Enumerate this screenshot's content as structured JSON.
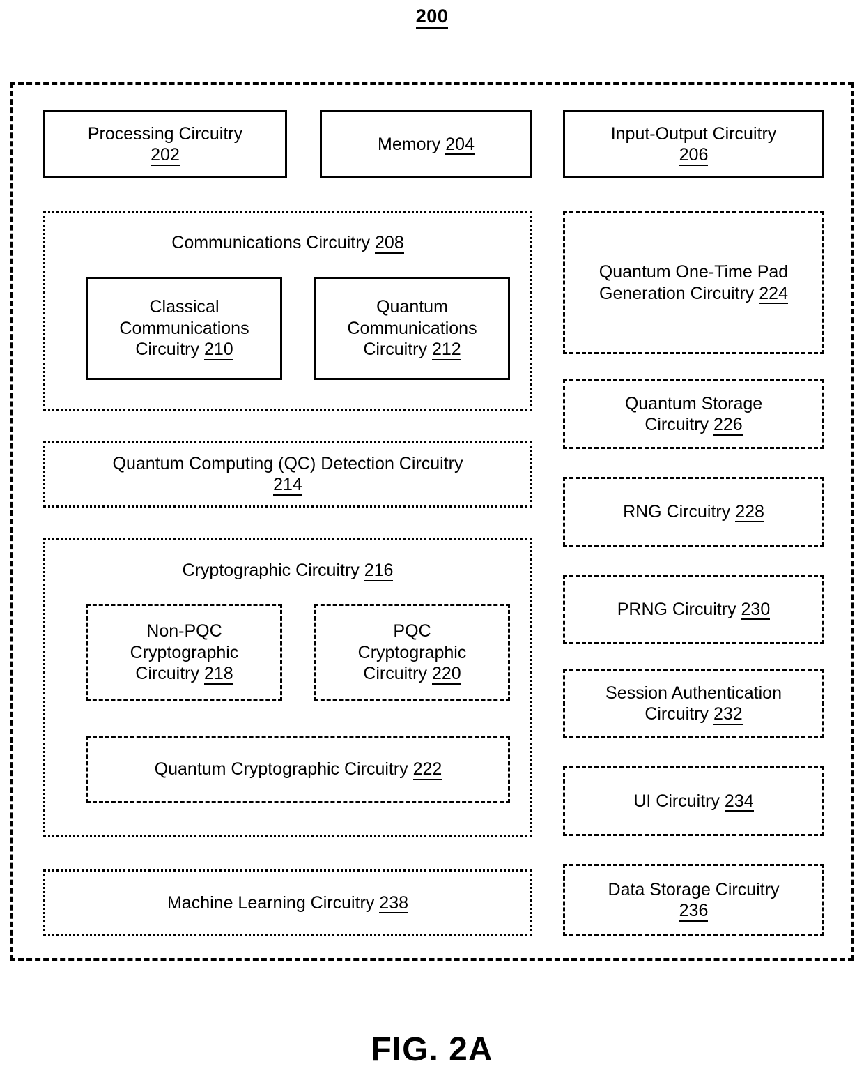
{
  "figure": {
    "number": "200",
    "caption": "FIG. 2A"
  },
  "apparatus": {
    "top_row": [
      {
        "name": "processing-circuitry",
        "title": "Processing Circuitry",
        "ref": "202",
        "style": "solid"
      },
      {
        "name": "memory",
        "title": "Memory",
        "ref": "204",
        "style": "solid"
      },
      {
        "name": "input-output-circuitry",
        "title": "Input-Output Circuitry",
        "ref": "206",
        "style": "solid"
      }
    ],
    "left_column": [
      {
        "name": "communications-circuitry",
        "title": "Communications Circuitry",
        "ref": "208",
        "style": "dotted",
        "children": [
          {
            "name": "classical-communications-circuitry",
            "title": "Classical Communications",
            "ref": "210",
            "style": "solid"
          },
          {
            "name": "quantum-communications-circuitry",
            "title": "Quantum Communications",
            "ref": "212",
            "style": "solid"
          }
        ]
      },
      {
        "name": "qc-detection-circuitry",
        "title": "Quantum Computing (QC) Detection Circuitry",
        "ref": "214",
        "style": "dotted",
        "children": []
      },
      {
        "name": "cryptographic-circuitry",
        "title": "Cryptographic Circuitry",
        "ref": "216",
        "style": "dotted",
        "children": [
          {
            "name": "non-pqc-cryptographic-circuitry",
            "title": "Non-PQC Cryptographic",
            "ref": "218",
            "style": "dashed"
          },
          {
            "name": "pqc-cryptographic-circuitry",
            "title": "PQC Cryptographic",
            "ref": "220",
            "style": "dashed"
          },
          {
            "name": "quantum-cryptographic-circuitry",
            "title": "Quantum Cryptographic Circuitry",
            "ref": "222",
            "style": "dashed"
          }
        ]
      },
      {
        "name": "machine-learning-circuitry",
        "title": "Machine Learning Circuitry",
        "ref": "238",
        "style": "dotted",
        "children": []
      }
    ],
    "right_column": [
      {
        "name": "quantum-one-time-pad-generation-circuitry",
        "title": "Quantum One-Time Pad Generation Circuitry",
        "ref": "224",
        "style": "dashed"
      },
      {
        "name": "quantum-storage-circuitry",
        "title": "Quantum Storage Circuitry",
        "ref": "226",
        "style": "dashed"
      },
      {
        "name": "rng-circuitry",
        "title": "RNG Circuitry",
        "ref": "228",
        "style": "dashed"
      },
      {
        "name": "prng-circuitry",
        "title": "PRNG Circuitry",
        "ref": "230",
        "style": "dashed"
      },
      {
        "name": "session-authentication-circuitry",
        "title": "Session Authentication Circuitry",
        "ref": "232",
        "style": "dashed"
      },
      {
        "name": "ui-circuitry",
        "title": "UI Circuitry",
        "ref": "234",
        "style": "dashed"
      },
      {
        "name": "data-storage-circuitry",
        "title": "Data Storage Circuitry",
        "ref": "236",
        "style": "dashed"
      }
    ]
  },
  "text": {
    "processing_circuitry_label": "Processing Circuitry 202",
    "memory_label": "Memory 204",
    "input_output_label": "Input-Output Circuitry 206",
    "communications_label": "Communications Circuitry 208",
    "classical_comm_label": "Classical Communications Circuitry 210",
    "quantum_comm_label": "Quantum Communications Circuitry 212",
    "qc_detection_label": "Quantum Computing (QC) Detection Circuitry 214",
    "cryptographic_label": "Cryptographic Circuitry 216",
    "non_pqc_label": "Non-PQC Cryptographic Circuitry 218",
    "pqc_label": "PQC Cryptographic Circuitry 220",
    "quantum_crypto_label": "Quantum Cryptographic Circuitry 222",
    "machine_learning_label": "Machine Learning Circuitry 238",
    "qotp_label": "Quantum One-Time Pad Generation Circuitry 224",
    "quantum_storage_label": "Quantum Storage Circuitry 226",
    "rng_label": "RNG Circuitry 228",
    "prng_label": "PRNG Circuitry 230",
    "session_auth_label": "Session Authentication Circuitry 232",
    "ui_label": "UI Circuitry 234",
    "data_storage_label": "Data Storage Circuitry 236"
  },
  "lines": {
    "processing": [
      "Processing Circuitry",
      "202"
    ],
    "memory": [
      "Memory",
      "204"
    ],
    "io": [
      "Input-Output Circuitry",
      "206"
    ],
    "communications": [
      "Communications Circuitry",
      "208"
    ],
    "classical": [
      "Classical",
      "Communications",
      "Circuitry",
      "210"
    ],
    "quantum_comm": [
      "Quantum",
      "Communications",
      "Circuitry",
      "212"
    ],
    "qc_detection": [
      "Quantum Computing (QC) Detection Circuitry",
      "214"
    ],
    "cryptographic": [
      "Cryptographic Circuitry",
      "216"
    ],
    "non_pqc": [
      "Non-PQC",
      "Cryptographic",
      "Circuitry",
      "218"
    ],
    "pqc": [
      "PQC",
      "Cryptographic",
      "Circuitry",
      "220"
    ],
    "quantum_crypto": [
      "Quantum Cryptographic Circuitry",
      "222"
    ],
    "machine_learning": [
      "Machine Learning Circuitry",
      "238"
    ],
    "qotp": [
      "Quantum One-Time Pad",
      "Generation Circuitry",
      "224"
    ],
    "quantum_storage": [
      "Quantum Storage",
      "Circuitry",
      "226"
    ],
    "rng": [
      "RNG Circuitry",
      "228"
    ],
    "prng": [
      "PRNG Circuitry",
      "230"
    ],
    "session_auth": [
      "Session Authentication",
      "Circuitry",
      "232"
    ],
    "ui": [
      "UI Circuitry",
      "234"
    ],
    "data_storage": [
      "Data Storage Circuitry",
      "236"
    ]
  }
}
